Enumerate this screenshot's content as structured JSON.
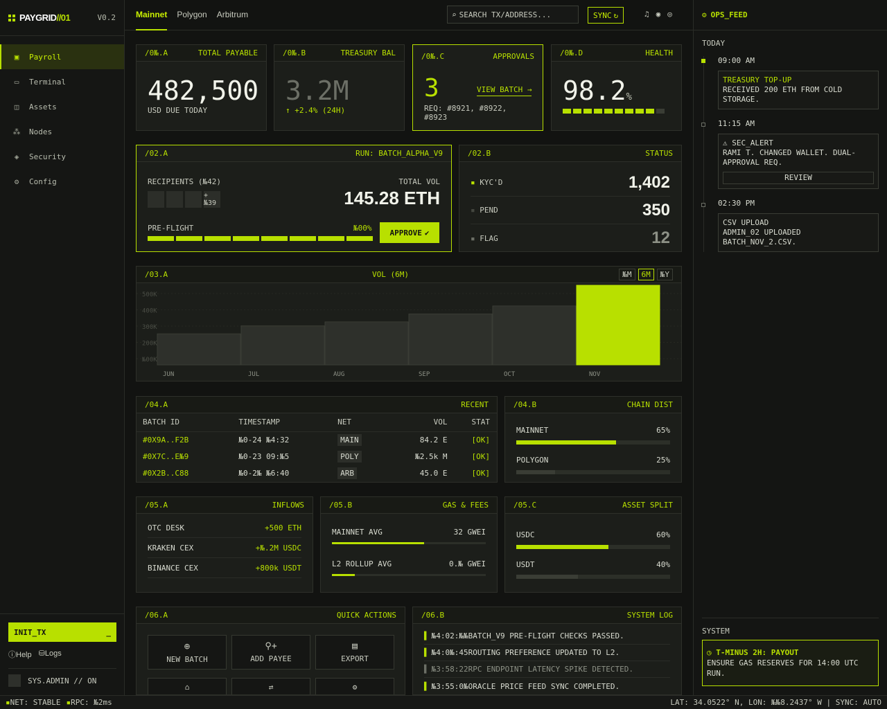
{
  "brand": {
    "name_a": "PAYGRID",
    "name_b": "//01",
    "version": "V0.2"
  },
  "nav": [
    {
      "label": "Payroll",
      "icon": "wallet-icon",
      "glyph": "▣"
    },
    {
      "label": "Terminal",
      "icon": "terminal-icon",
      "glyph": "▭"
    },
    {
      "label": "Assets",
      "icon": "assets-icon",
      "glyph": "◫"
    },
    {
      "label": "Nodes",
      "icon": "nodes-icon",
      "glyph": "⁂"
    },
    {
      "label": "Security",
      "icon": "shield-icon",
      "glyph": "◈"
    },
    {
      "label": "Config",
      "icon": "gear-icon",
      "glyph": "⚙"
    }
  ],
  "side": {
    "init_label": "INIT_TX",
    "init_cursor": "_",
    "help": "Help",
    "logs": "Logs",
    "user": "SYS.ADMIN // ON"
  },
  "tabs": [
    "Mainnet",
    "Polygon",
    "Arbitrum"
  ],
  "search": {
    "placeholder": "SEARCH TX/ADDRESS..."
  },
  "sync": "SYNC",
  "kpi": [
    {
      "id": "/0№.A",
      "title": "TOTAL PAYABLE",
      "value": "482,500",
      "sub": "USD DUE TODAY"
    },
    {
      "id": "/0№.B",
      "title": "TREASURY BAL",
      "value": "3.2M",
      "sub": "↑ +2.4% (24H)"
    },
    {
      "id": "/0№.C",
      "title": "APPROVALS",
      "value": "3",
      "link": "VIEW BATCH →",
      "sub": "REQ: #8921, #8922, #8923"
    },
    {
      "id": "/0№.D",
      "title": "HEALTH",
      "value": "98.2",
      "unit": "%",
      "health_segments_filled": 9,
      "health_segments_total": 10
    }
  ],
  "batch": {
    "id": "/02.A",
    "run": "RUN: BATCH_ALPHA_V9",
    "recipients": "RECIPIENTS (№42)",
    "more": "+№39",
    "total_label": "TOTAL VOL",
    "total": "145.28 ETH",
    "preflight": "PRE-FLIGHT",
    "pct": "№00%",
    "approve": "APPROVE"
  },
  "status": {
    "id": "/02.B",
    "title": "STATUS",
    "rows": [
      {
        "label": "KYC'D",
        "value": "1,402"
      },
      {
        "label": "PEND",
        "value": "350"
      },
      {
        "label": "FLAG",
        "value": "12"
      }
    ]
  },
  "vol": {
    "id": "/03.A",
    "title": "VOL (6M)",
    "ranges": [
      "№M",
      "6M",
      "№Y"
    ],
    "active_range": "6M"
  },
  "chart_data": {
    "type": "bar",
    "title": "VOL (6M)",
    "categories": [
      "JUN",
      "JUL",
      "AUG",
      "SEP",
      "OCT",
      "NOV"
    ],
    "values": [
      195,
      245,
      270,
      320,
      370,
      500
    ],
    "ylim": [
      0,
      500
    ],
    "yticks": [
      "500K",
      "400K",
      "300K",
      "200K",
      "№00K"
    ],
    "highlight": "NOV"
  },
  "recent": {
    "id": "/04.A",
    "title": "RECENT",
    "cols": [
      "BATCH ID",
      "TIMESTAMP",
      "NET",
      "VOL",
      "STAT"
    ],
    "rows": [
      [
        "#0X9A..F2B",
        "№0-24 №4:32",
        "MAIN",
        "84.2 E",
        "[OK]"
      ],
      [
        "#0X7C..E№9",
        "№0-23 09:№5",
        "POLY",
        "№2.5k M",
        "[OK]"
      ],
      [
        "#0X2B..C88",
        "№0-2№ №6:40",
        "ARB",
        "45.0 E",
        "[OK]"
      ]
    ]
  },
  "chain": {
    "id": "/04.B",
    "title": "CHAIN DIST",
    "rows": [
      {
        "label": "MAINNET",
        "pct": "65%",
        "value": 65
      },
      {
        "label": "POLYGON",
        "pct": "25%",
        "value": 25
      }
    ]
  },
  "inflows": {
    "id": "/05.A",
    "title": "INFLOWS",
    "rows": [
      {
        "label": "OTC DESK",
        "value": "+500 ETH"
      },
      {
        "label": "KRAKEN CEX",
        "value": "+№.2M USDC"
      },
      {
        "label": "BINANCE CEX",
        "value": "+800k USDT"
      }
    ]
  },
  "gas": {
    "id": "/05.B",
    "title": "GAS & FEES",
    "rows": [
      {
        "label": "MAINNET AVG",
        "value": "32 GWEI",
        "fill": 60
      },
      {
        "label": "L2 ROLLUP AVG",
        "value": "0.№ GWEI",
        "fill": 15
      }
    ]
  },
  "split": {
    "id": "/05.C",
    "title": "ASSET SPLIT",
    "rows": [
      {
        "label": "USDC",
        "pct": "60%",
        "value": 60
      },
      {
        "label": "USDT",
        "pct": "40%",
        "value": 40
      }
    ]
  },
  "quick": {
    "id": "/06.A",
    "title": "QUICK ACTIONS",
    "buttons": [
      "NEW BATCH",
      "ADD PAYEE",
      "EXPORT"
    ]
  },
  "syslog": {
    "id": "/06.B",
    "title": "SYSTEM LOG",
    "rows": [
      {
        "time": "№4:02:№№",
        "msg": "BATCH_V9 PRE-FLIGHT CHECKS PASSED."
      },
      {
        "time": "№4:0№:45",
        "msg": "ROUTING PREFERENCE UPDATED TO L2."
      },
      {
        "time": "№3:58:22",
        "msg": "RPC ENDPOINT LATENCY SPIKE DETECTED."
      },
      {
        "time": "№3:55:0№",
        "msg": "ORACLE PRICE FEED SYNC COMPLETED."
      }
    ]
  },
  "feed": {
    "title": "OPS_FEED",
    "day": "TODAY",
    "items": [
      {
        "time": "09:00 AM",
        "title": "TREASURY TOP-UP",
        "body": "RECEIVED 200 ETH FROM COLD STORAGE."
      },
      {
        "time": "11:15 AM",
        "title": "SEC_ALERT",
        "body": "RAMI T. CHANGED WALLET. DUAL-APPROVAL REQ.",
        "action": "REVIEW"
      },
      {
        "time": "02:30 PM",
        "title": "CSV UPLOAD",
        "body": "ADMIN_02 UPLOADED BATCH_NOV_2.CSV."
      }
    ]
  },
  "system": {
    "label": "SYSTEM",
    "title": "T-MINUS 2H: PAYOUT",
    "body": "ENSURE GAS RESERVES FOR 14:00 UTC RUN."
  },
  "statusbar": {
    "net": "NET: STABLE",
    "rpc": "RPC: №2ms",
    "coords": "LAT: 34.0522° N, LON: №№8.2437° W | SYNC: AUTO"
  }
}
